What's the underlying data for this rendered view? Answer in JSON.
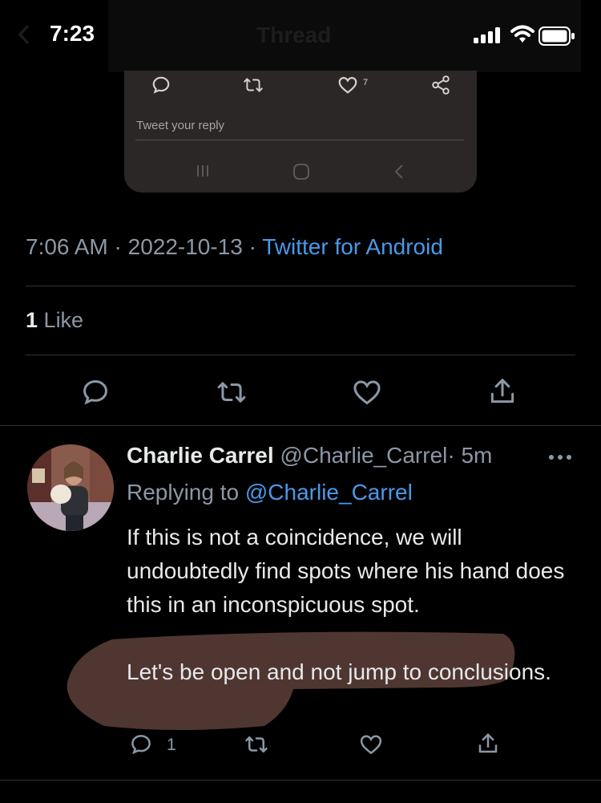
{
  "status_bar": {
    "time": "7:23",
    "faint_title": "Thread"
  },
  "embedded_screenshot": {
    "like_count": "7",
    "reply_placeholder": "Tweet your reply"
  },
  "tweet_meta": {
    "time": "7:06 AM",
    "separator": "·",
    "date": "2022-10-13",
    "source": "Twitter for Android"
  },
  "engagement": {
    "like_count": "1",
    "like_label": "Like"
  },
  "reply": {
    "display_name": "Charlie Carrel",
    "handle": "@Charlie_Carrel",
    "separator": "·",
    "age": "5m",
    "replying_prefix": "Replying to",
    "replying_to": "@Charlie_Carrel",
    "paragraph_1": "If this is not a coincidence, we will undoubtedly find spots where his hand does this in an inconspicuous spot.",
    "paragraph_2": "Let's be open and not jump to conclusions.",
    "reply_count": "1"
  },
  "colors": {
    "accent": "#4a99e9",
    "secondary_text": "#8b98a5",
    "primary_text": "#e7e9ea",
    "background": "#000000"
  }
}
